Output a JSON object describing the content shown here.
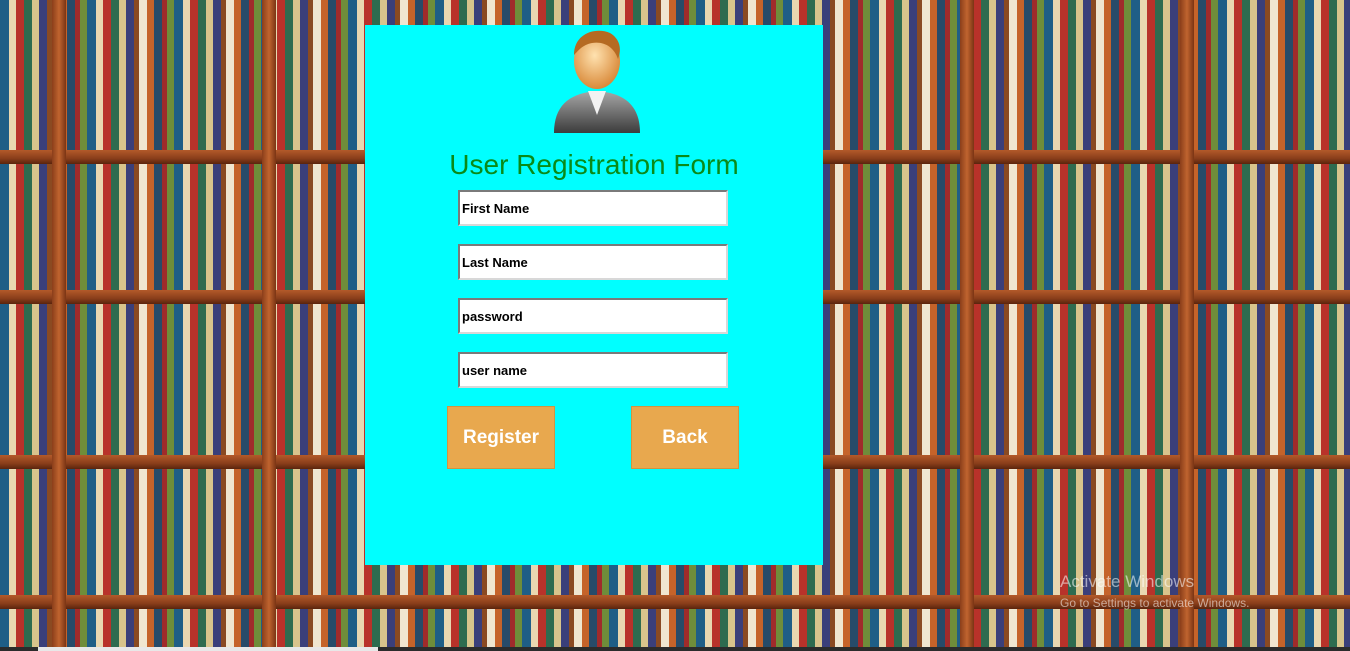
{
  "form": {
    "title": "User Registration Form",
    "fields": [
      {
        "name": "first-name",
        "value": "First Name"
      },
      {
        "name": "last-name",
        "value": "Last Name"
      },
      {
        "name": "password",
        "value": "password"
      },
      {
        "name": "user-name",
        "value": "user name"
      }
    ],
    "register_label": "Register",
    "back_label": "Back"
  },
  "watermark": {
    "line1": "Activate Windows",
    "line2": "Go to Settings to activate Windows."
  },
  "colors": {
    "panel": "#00ffff",
    "title": "#0a8a18",
    "button": "#e8a84e"
  },
  "icons": {
    "avatar": "user-avatar-icon"
  }
}
